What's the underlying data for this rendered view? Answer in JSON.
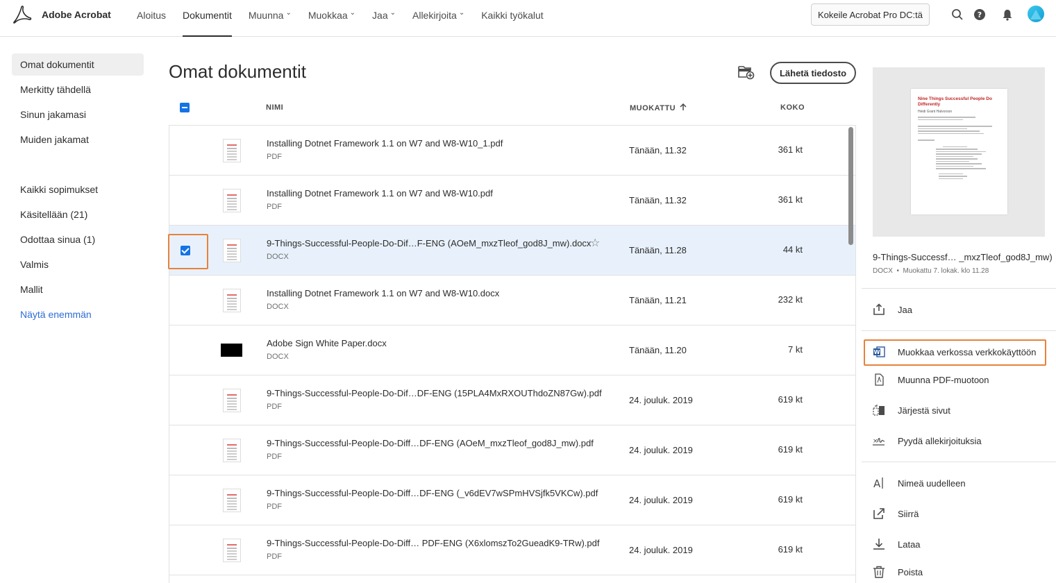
{
  "brand": {
    "name": "Adobe Acrobat"
  },
  "nav": [
    {
      "label": "Aloitus",
      "active": false,
      "dropdown": false
    },
    {
      "label": "Dokumentit",
      "active": true,
      "dropdown": false
    },
    {
      "label": "Muunna",
      "active": false,
      "dropdown": true
    },
    {
      "label": "Muokkaa",
      "active": false,
      "dropdown": true
    },
    {
      "label": "Jaa",
      "active": false,
      "dropdown": true
    },
    {
      "label": "Allekirjoita",
      "active": false,
      "dropdown": true
    },
    {
      "label": "Kaikki työkalut",
      "active": false,
      "dropdown": false
    }
  ],
  "header": {
    "try_button": "Kokeile Acrobat Pro DC:tä",
    "icons": [
      "search-icon",
      "help-icon",
      "bell-icon",
      "avatar"
    ]
  },
  "sidebar": {
    "items": [
      {
        "label": "Omat dokumentit",
        "active": true
      },
      {
        "label": "Merkitty tähdellä"
      },
      {
        "label": "Sinun jakamasi"
      },
      {
        "label": "Muiden jakamat"
      },
      {
        "label": "Kaikki sopimukset"
      },
      {
        "label": "Käsitellään (21)"
      },
      {
        "label": "Odottaa sinua (1)"
      },
      {
        "label": "Valmis"
      },
      {
        "label": "Mallit"
      },
      {
        "label": "Näytä enemmän",
        "link": true
      }
    ]
  },
  "main": {
    "title": "Omat dokumentit",
    "upload_button": "Lähetä tiedosto",
    "columns": {
      "name": "NIMI",
      "modified": "MUOKATTU",
      "size": "KOKO"
    },
    "files": [
      {
        "name": "Installing Dotnet Framework 1.1 on W7 and W8-W10_1.pdf",
        "type": "PDF",
        "modified": "Tänään, 11.32",
        "size": "361 kt"
      },
      {
        "name": "Installing Dotnet Framework 1.1 on W7 and W8-W10.pdf",
        "type": "PDF",
        "modified": "Tänään, 11.32",
        "size": "361 kt"
      },
      {
        "name": "9-Things-Successful-People-Do-Dif…F-ENG (AOeM_mxzTleof_god8J_mw).docx",
        "type": "DOCX",
        "modified": "Tänään, 11.28",
        "size": "44 kt",
        "selected": true,
        "star": true
      },
      {
        "name": "Installing Dotnet Framework 1.1 on W7 and W8-W10.docx",
        "type": "DOCX",
        "modified": "Tänään, 11.21",
        "size": "232 kt"
      },
      {
        "name": "Adobe Sign White Paper.docx",
        "type": "DOCX",
        "modified": "Tänään, 11.20",
        "size": "7 kt",
        "dark_thumb": true
      },
      {
        "name": "9-Things-Successful-People-Do-Dif…DF-ENG (15PLA4MxRXOUThdoZN87Gw).pdf",
        "type": "PDF",
        "modified": "24. jouluk. 2019",
        "size": "619 kt"
      },
      {
        "name": "9-Things-Successful-People-Do-Diff…DF-ENG (AOeM_mxzTleof_god8J_mw).pdf",
        "type": "PDF",
        "modified": "24. jouluk. 2019",
        "size": "619 kt"
      },
      {
        "name": "9-Things-Successful-People-Do-Diff…DF-ENG (_v6dEV7wSPmHVSjfk5VKCw).pdf",
        "type": "PDF",
        "modified": "24. jouluk. 2019",
        "size": "619 kt"
      },
      {
        "name": "9-Things-Successful-People-Do-Diff… PDF-ENG (X6xlomszTo2GueadK9-TRw).pdf",
        "type": "PDF",
        "modified": "24. jouluk. 2019",
        "size": "619 kt"
      }
    ]
  },
  "panel": {
    "preview": {
      "title": "Nine Things Successful People Do Differently",
      "author": "Heidi Grant Halvorson"
    },
    "file_name": "9-Things-Successf… _mxzTleof_god8J_mw)",
    "file_type": "DOCX",
    "file_meta": "Muokattu 7. lokak. klo 11.28",
    "actions_group1": [
      {
        "label": "Jaa",
        "icon": "share-icon"
      }
    ],
    "actions_group2": [
      {
        "label": "Muokkaa verkossa verkkokäyttöön",
        "icon": "word-icon",
        "highlight": true
      },
      {
        "label": "Muunna PDF-muotoon",
        "icon": "pdf-file-icon"
      },
      {
        "label": "Järjestä sivut",
        "icon": "organize-pages-icon"
      },
      {
        "label": "Pyydä allekirjoituksia",
        "icon": "signature-icon"
      }
    ],
    "actions_group3": [
      {
        "label": "Nimeä uudelleen",
        "icon": "rename-icon"
      },
      {
        "label": "Siirrä",
        "icon": "move-icon"
      },
      {
        "label": "Lataa",
        "icon": "download-icon"
      },
      {
        "label": "Poista",
        "icon": "trash-icon"
      }
    ]
  },
  "colors": {
    "accent": "#1473e6",
    "highlight": "#e8813a",
    "selected_row": "#e8f1fb",
    "link": "#2d6cd6"
  }
}
